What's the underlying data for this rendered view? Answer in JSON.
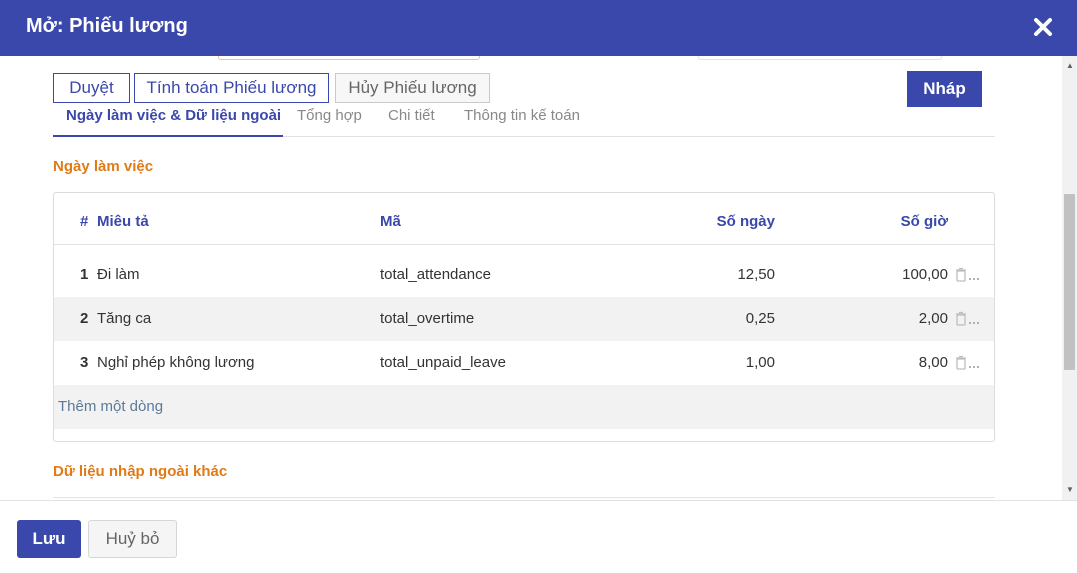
{
  "modal": {
    "title": "Mở: Phiếu lương"
  },
  "toolbar": {
    "approve_label": "Duyệt",
    "compute_label": "Tính toán Phiếu lương",
    "cancel_payslip_label": "Hủy Phiếu lương",
    "status": "Nháp"
  },
  "tabs": [
    {
      "label": "Ngày làm việc & Dữ liệu ngoài",
      "active": true
    },
    {
      "label": "Tổng hợp",
      "active": false
    },
    {
      "label": "Chi tiết",
      "active": false
    },
    {
      "label": "Thông tin kế toán",
      "active": false
    }
  ],
  "worked_days": {
    "section_title": "Ngày làm việc",
    "columns": {
      "index": "#",
      "description": "Miêu tả",
      "code": "Mã",
      "days": "Số ngày",
      "hours": "Số giờ"
    },
    "rows": [
      {
        "index": "1",
        "description": "Đi làm",
        "code": "total_attendance",
        "days": "12,50",
        "hours": "100,00"
      },
      {
        "index": "2",
        "description": "Tăng ca",
        "code": "total_overtime",
        "days": "0,25",
        "hours": "2,00"
      },
      {
        "index": "3",
        "description": "Nghỉ phép không lương",
        "code": "total_unpaid_leave",
        "days": "1,00",
        "hours": "8,00"
      }
    ],
    "add_line_label": "Thêm một dòng"
  },
  "other_inputs": {
    "section_title": "Dữ liệu nhập ngoài khác"
  },
  "footer": {
    "save_label": "Lưu",
    "discard_label": "Huỷ bỏ"
  },
  "colors": {
    "primary": "#3a48ab",
    "section_orange": "#e07b17",
    "row_alt": "#f2f2f2"
  },
  "icons": {
    "close": "close-icon",
    "trash": "trash-icon"
  }
}
